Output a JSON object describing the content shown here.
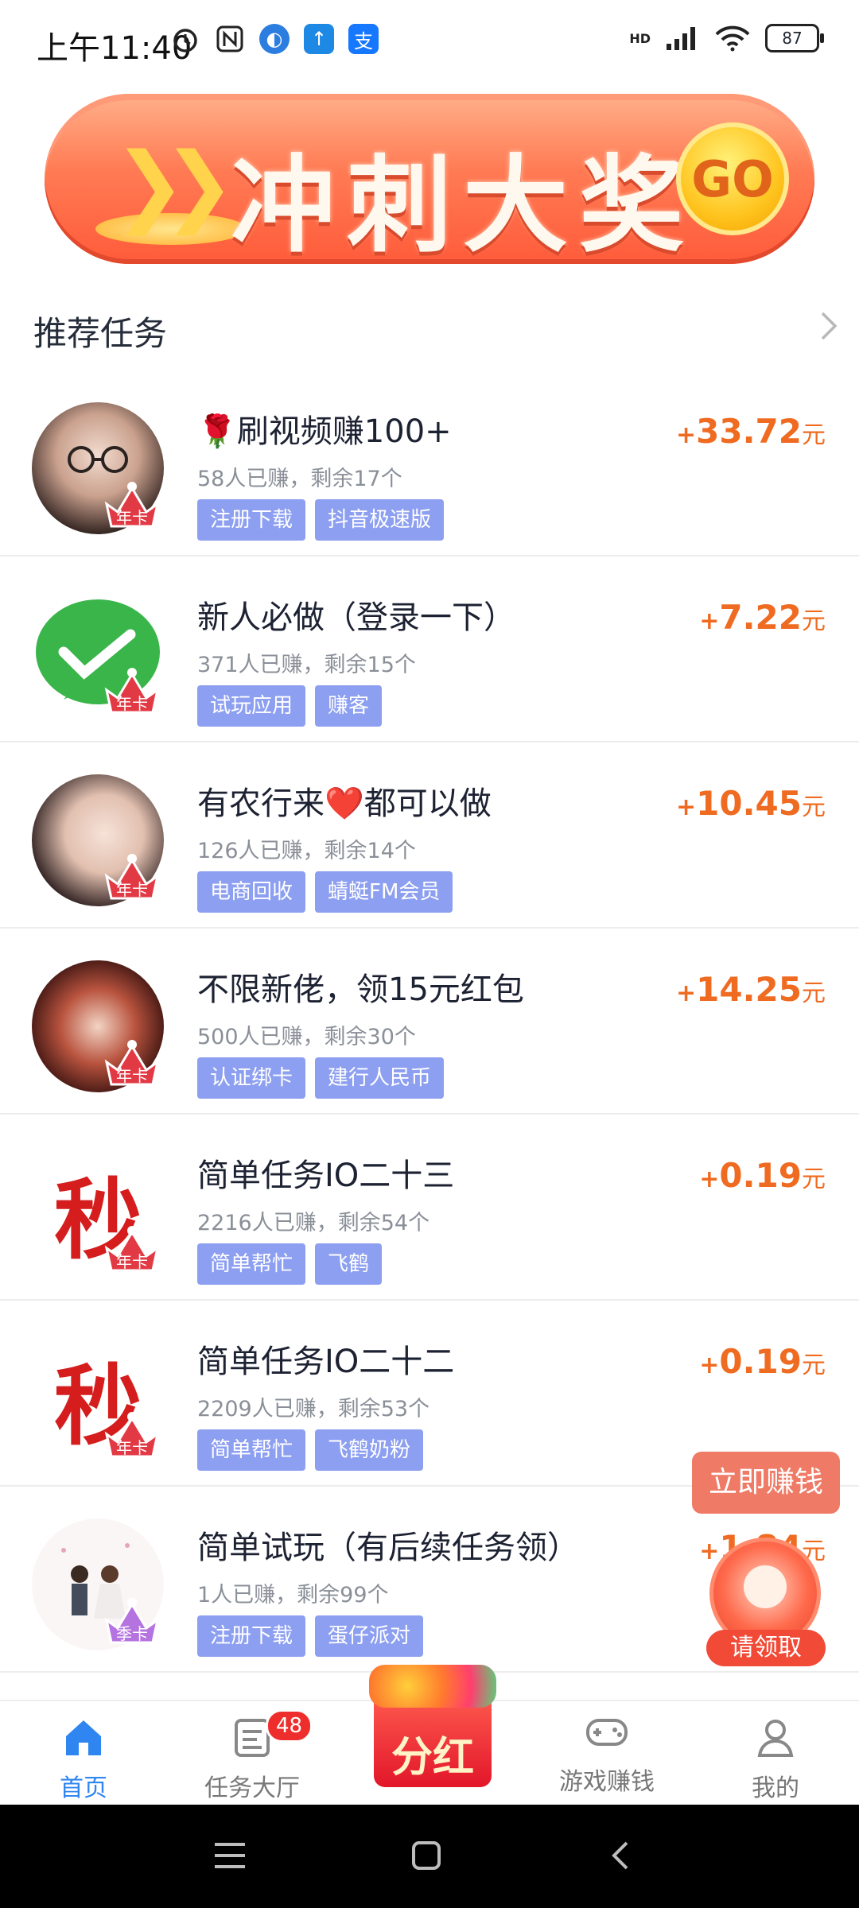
{
  "status_bar": {
    "time": "上午11:40",
    "battery": "87",
    "network": "HD"
  },
  "banner": {
    "title": "冲刺大奖",
    "go": "GO"
  },
  "section": {
    "title": "推荐任务"
  },
  "tasks": [
    {
      "title": "刷视频赚100+",
      "stats": "58人已赚，剩余17个",
      "tags": [
        "注册下载",
        "抖音极速版"
      ],
      "reward": {
        "plus": "+",
        "amount": "33.72",
        "unit": "元"
      },
      "badge": "年卡",
      "avatar": "portrait-girl-glasses"
    },
    {
      "title": "新人必做（登录一下）",
      "stats": "371人已赚，剩余15个",
      "tags": [
        "试玩应用",
        "赚客"
      ],
      "reward": {
        "plus": "+",
        "amount": "7.22",
        "unit": "元"
      },
      "badge": "年卡",
      "avatar": "wechat-logo"
    },
    {
      "title": "有农行来❤️都可以做",
      "stats": "126人已赚，剩余14个",
      "tags": [
        "电商回收",
        "蜻蜓FM会员"
      ],
      "reward": {
        "plus": "+",
        "amount": "10.45",
        "unit": "元"
      },
      "badge": "年卡",
      "avatar": "portrait-girl"
    },
    {
      "title": "不限新佬，领15元红包",
      "stats": "500人已赚，剩余30个",
      "tags": [
        "认证绑卡",
        "建行人民币"
      ],
      "reward": {
        "plus": "+",
        "amount": "14.25",
        "unit": "元"
      },
      "badge": "年卡",
      "avatar": "portrait-girl-red"
    },
    {
      "title": "简单任务IO二十三",
      "stats": "2216人已赚，剩余54个",
      "tags": [
        "简单帮忙",
        "飞鹤"
      ],
      "reward": {
        "plus": "+",
        "amount": "0.19",
        "unit": "元"
      },
      "badge": "年卡",
      "avatar": "miao-character",
      "avatar_text": "秒"
    },
    {
      "title": "简单任务IO二十二",
      "stats": "2209人已赚，剩余53个",
      "tags": [
        "简单帮忙",
        "飞鹤奶粉"
      ],
      "reward": {
        "plus": "+",
        "amount": "0.19",
        "unit": "元"
      },
      "badge": "年卡",
      "avatar": "miao-character",
      "avatar_text": "秒"
    },
    {
      "title": "简单试玩（有后续任务领）",
      "stats": "1人已赚，剩余99个",
      "tags": [
        "注册下载",
        "蛋仔派对"
      ],
      "reward": {
        "plus": "+",
        "amount": "1.84",
        "unit": "元"
      },
      "badge": "季卡",
      "avatar": "wedding-couple"
    }
  ],
  "floating": {
    "button": "立即赚钱",
    "label": "请领取"
  },
  "bottom_nav": {
    "items": [
      {
        "label": "首页",
        "icon": "home-icon"
      },
      {
        "label": "任务大厅",
        "icon": "task-list-icon",
        "badge": "48"
      },
      {
        "label": "分红",
        "icon": "gift-box-icon"
      },
      {
        "label": "游戏赚钱",
        "icon": "gamepad-icon"
      },
      {
        "label": "我的",
        "icon": "person-icon"
      }
    ]
  },
  "colors": {
    "accent": "#2f86f0",
    "reward": "#f06b22",
    "tag": "#8d9ff0"
  }
}
